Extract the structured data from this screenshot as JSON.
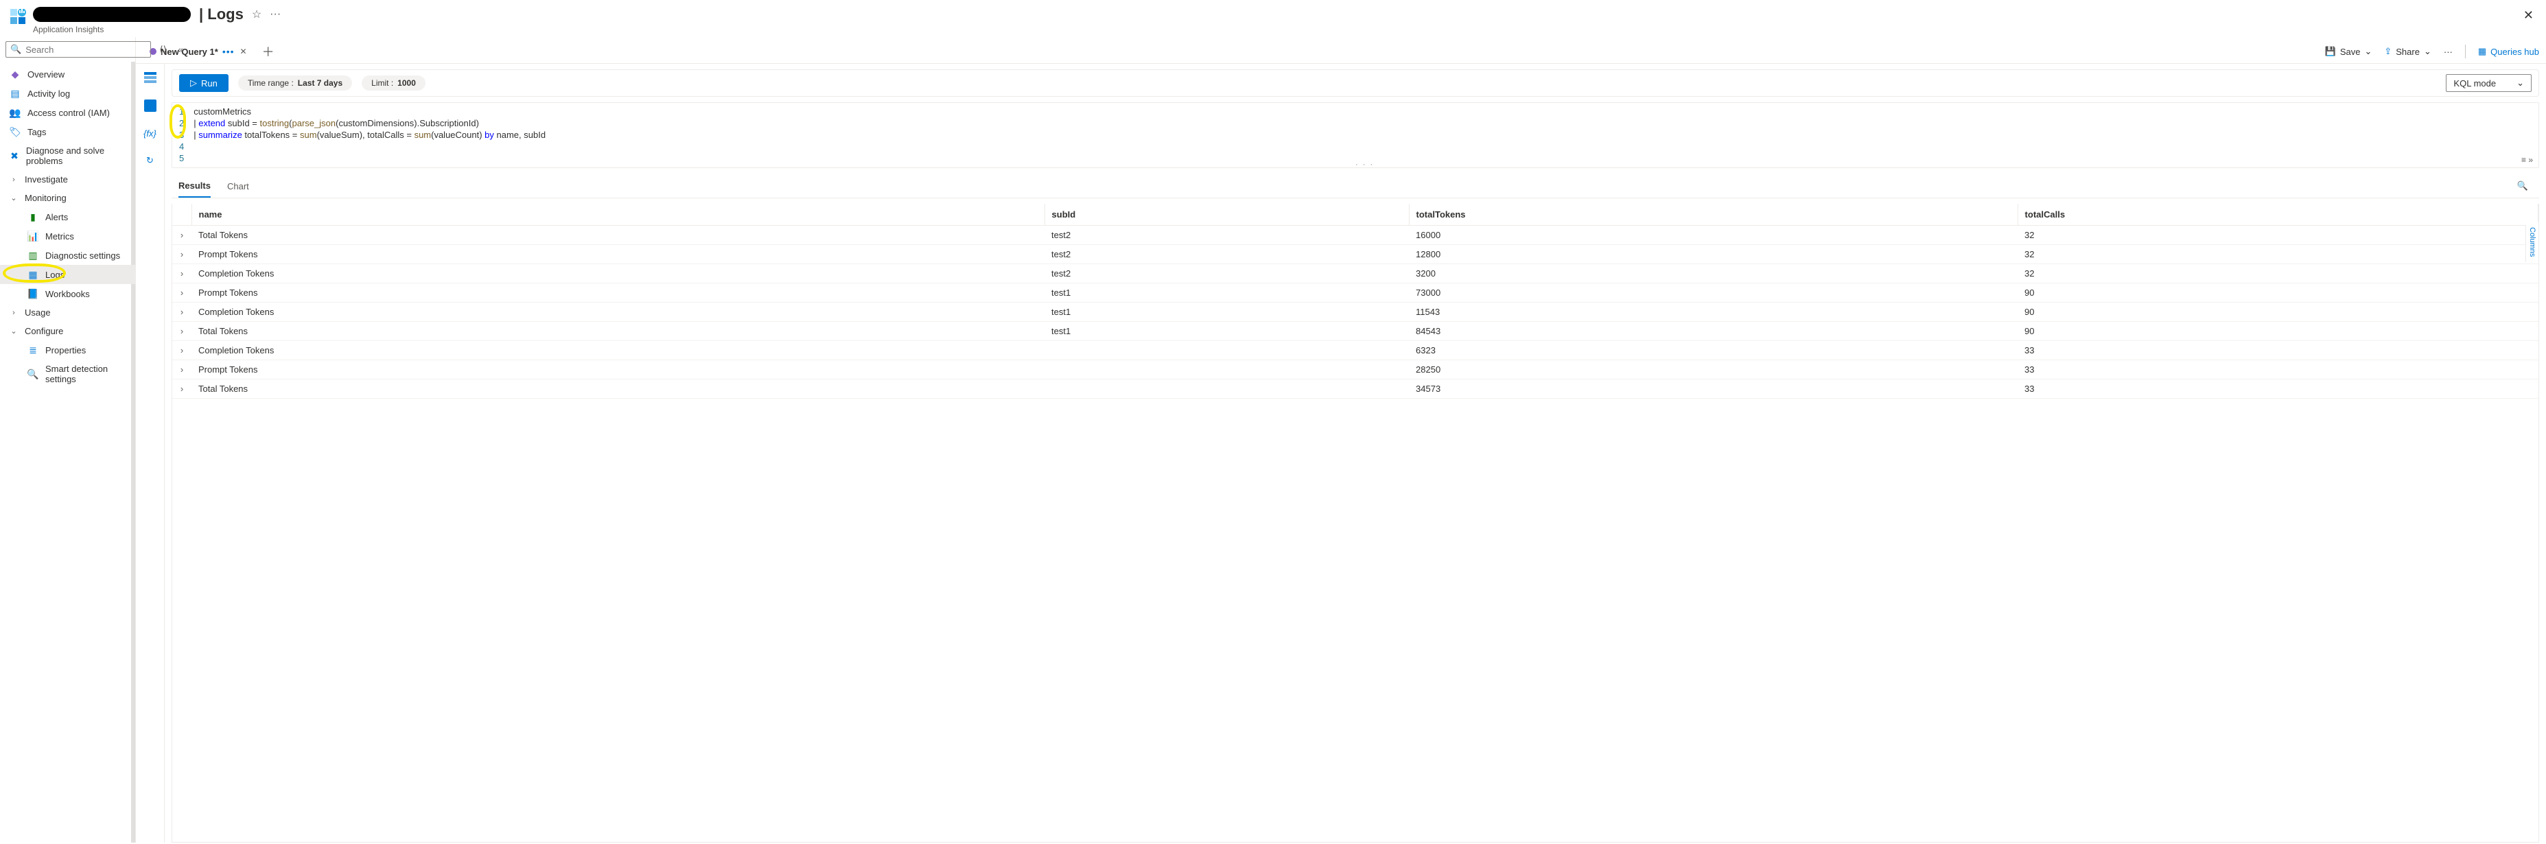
{
  "header": {
    "app_icon": "app-insights",
    "title_suffix": "| Logs",
    "subtitle": "Application Insights",
    "star_tooltip": "Favorite",
    "more_tooltip": "More"
  },
  "sidebar": {
    "search_placeholder": "Search",
    "collapse_label": "«",
    "items": [
      {
        "kind": "item",
        "icon": "overview-icon",
        "icon_cls": "c-purple",
        "label": "Overview"
      },
      {
        "kind": "item",
        "icon": "activity-icon",
        "icon_cls": "c-blue",
        "label": "Activity log"
      },
      {
        "kind": "item",
        "icon": "iam-icon",
        "icon_cls": "c-blue",
        "label": "Access control (IAM)"
      },
      {
        "kind": "item",
        "icon": "tags-icon",
        "icon_cls": "c-blue",
        "label": "Tags"
      },
      {
        "kind": "item",
        "icon": "diagnose-icon",
        "icon_cls": "c-blue",
        "label": "Diagnose and solve problems"
      },
      {
        "kind": "section",
        "chev": ">",
        "label": "Investigate"
      },
      {
        "kind": "section",
        "chev": "v",
        "label": "Monitoring"
      },
      {
        "kind": "child",
        "icon": "alerts-icon",
        "icon_cls": "c-green",
        "label": "Alerts"
      },
      {
        "kind": "child",
        "icon": "metrics-icon",
        "icon_cls": "c-blue",
        "label": "Metrics"
      },
      {
        "kind": "child",
        "icon": "diagset-icon",
        "icon_cls": "c-green",
        "label": "Diagnostic settings"
      },
      {
        "kind": "child",
        "icon": "logs-icon",
        "icon_cls": "c-blue",
        "label": "Logs",
        "active": true,
        "highlight": true
      },
      {
        "kind": "child",
        "icon": "workbooks-icon",
        "icon_cls": "c-blue",
        "label": "Workbooks"
      },
      {
        "kind": "section",
        "chev": ">",
        "label": "Usage"
      },
      {
        "kind": "section",
        "chev": "v",
        "label": "Configure"
      },
      {
        "kind": "child",
        "icon": "props-icon",
        "icon_cls": "c-blue",
        "label": "Properties"
      },
      {
        "kind": "child",
        "icon": "smart-icon",
        "icon_cls": "c-blue",
        "label": "Smart detection settings"
      }
    ]
  },
  "tabbar": {
    "tab_label": "New Query 1*",
    "save_label": "Save",
    "share_label": "Share",
    "queries_hub": "Queries hub"
  },
  "rail": {
    "items": [
      "tables-icon",
      "tables2-icon",
      "functions-icon",
      "history-icon"
    ]
  },
  "toolbar": {
    "run_label": "Run",
    "timerange_label": "Time range :",
    "timerange_value": "Last 7 days",
    "limit_label": "Limit :",
    "limit_value": "1000",
    "mode_label": "KQL mode"
  },
  "query": {
    "lines": [
      {
        "n": 1,
        "text": "customMetrics"
      },
      {
        "n": 2,
        "text": "| extend subId = tostring(parse_json(customDimensions).SubscriptionId)"
      },
      {
        "n": 3,
        "text": "| summarize totalTokens = sum(valueSum), totalCalls = sum(valueCount) by name, subId"
      },
      {
        "n": 4,
        "text": ""
      },
      {
        "n": 5,
        "text": ""
      }
    ]
  },
  "results": {
    "tab_results": "Results",
    "tab_chart": "Chart",
    "columns_label": "Columns",
    "headers": [
      "name",
      "subId",
      "totalTokens",
      "totalCalls"
    ],
    "rows": [
      [
        "Total Tokens",
        "test2",
        "16000",
        "32"
      ],
      [
        "Prompt Tokens",
        "test2",
        "12800",
        "32"
      ],
      [
        "Completion Tokens",
        "test2",
        "3200",
        "32"
      ],
      [
        "Prompt Tokens",
        "test1",
        "73000",
        "90"
      ],
      [
        "Completion Tokens",
        "test1",
        "11543",
        "90"
      ],
      [
        "Total Tokens",
        "test1",
        "84543",
        "90"
      ],
      [
        "Completion Tokens",
        "",
        "6323",
        "33"
      ],
      [
        "Prompt Tokens",
        "",
        "28250",
        "33"
      ],
      [
        "Total Tokens",
        "",
        "34573",
        "33"
      ]
    ]
  }
}
